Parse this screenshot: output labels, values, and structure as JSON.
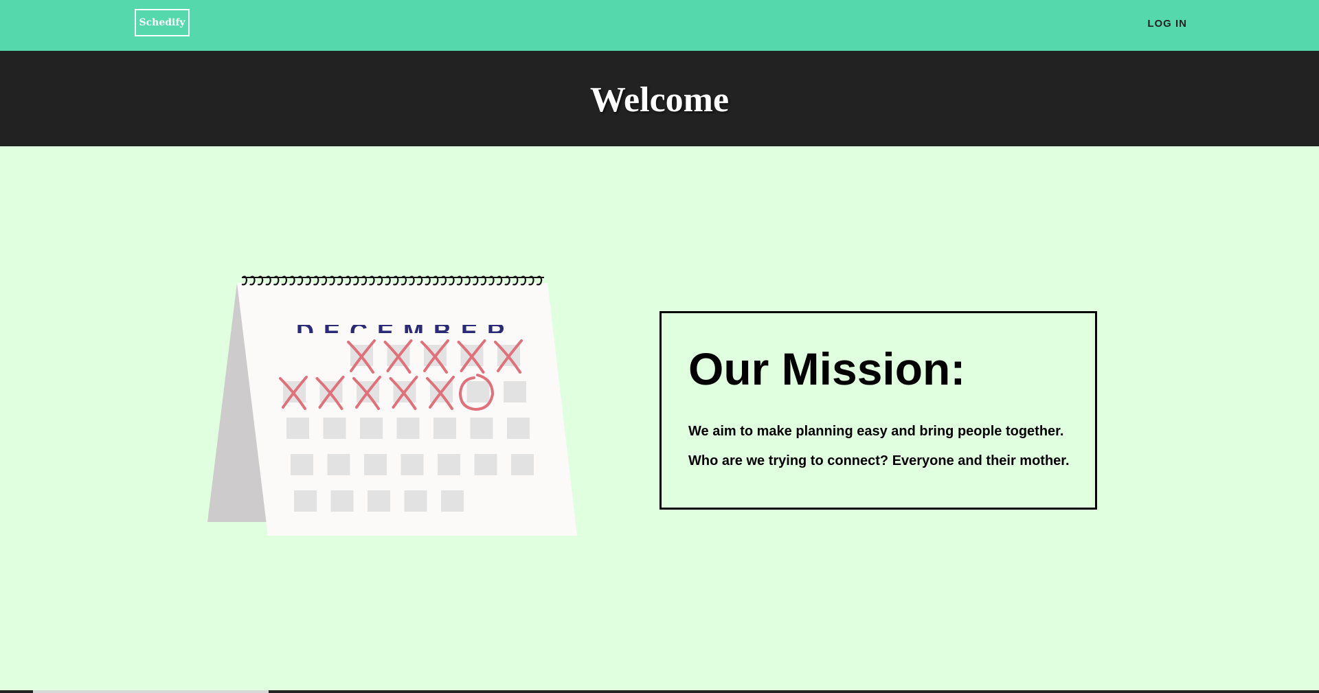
{
  "nav": {
    "brand": "Schedify",
    "login_label": "LOG IN"
  },
  "hero": {
    "title": "Welcome"
  },
  "calendar": {
    "month": "DECEMBER"
  },
  "mission": {
    "title": "Our Mission:",
    "line1": "We aim to make planning easy and bring people together.",
    "line2": "Who are we trying to connect? Everyone and their mother."
  },
  "colors": {
    "nav_bg": "#55d8ab",
    "hero_bg": "#222222",
    "page_bg": "#e0ffdf",
    "mark": "#e0707a"
  }
}
